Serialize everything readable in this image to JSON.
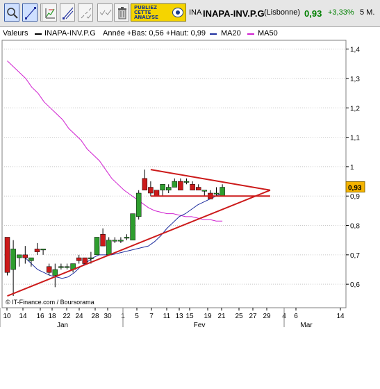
{
  "toolbar": {
    "tools": [
      {
        "name": "zoom-tool-button",
        "icon": "magnifier-icon",
        "active": true
      },
      {
        "name": "trendline-tool-button",
        "icon": "trendline-icon",
        "active": true
      },
      {
        "name": "channel-tool-button",
        "icon": "channel-icon",
        "active": false
      },
      {
        "name": "hline-tool-button",
        "icon": "horizontal-line-icon",
        "active": false
      },
      {
        "name": "fibonacci-tool-button",
        "icon": "fibonacci-icon",
        "active": false
      },
      {
        "name": "fan-tool-button",
        "icon": "fan-icon",
        "active": false
      },
      {
        "name": "erase-tool-button",
        "icon": "checkmarks-icon",
        "active": false
      },
      {
        "name": "trash-tool-button",
        "icon": "trash-icon",
        "active": false
      }
    ],
    "brand": {
      "line1": "PUBLIEZ",
      "line2": "CETTE",
      "line3": "ANALYSE"
    }
  },
  "header": {
    "ticker": "INA",
    "isin": "INAPA-INV.P.G",
    "market": "(Lisbonne)",
    "price": "0,93",
    "change": "+3,33%",
    "period": "5 M."
  },
  "legend": {
    "title": "Valeurs",
    "series_name": "INAPA-INV.P.G",
    "stats": "Année +Bas: 0,56 +Haut: 0,99",
    "ma20": "MA20",
    "ma50": "MA50"
  },
  "colors": {
    "up": "#2e9e2e",
    "down": "#cc1a1a",
    "ma20": "#1f2f9f",
    "ma50": "#d020d0",
    "trendline": "#cc1a1a",
    "last_price_tag": "#f5b400"
  },
  "credit": "© IT-Finance.com / Boursorama",
  "chart_data": {
    "type": "candlestick",
    "ylim": [
      0.52,
      1.43
    ],
    "yticks": [
      "1,4",
      "1,3",
      "1,2",
      "1,1",
      "1",
      "0,9",
      "0,8",
      "0,7",
      "0,6"
    ],
    "xticks": [
      "10",
      "14",
      "16",
      "18",
      "22",
      "24",
      "28",
      "30",
      "1",
      "5",
      "7",
      "11",
      "13",
      "15",
      "19",
      "21",
      "25",
      "27",
      "29",
      "4",
      "6",
      "14"
    ],
    "months": [
      "Jan",
      "Fev",
      "Mar"
    ],
    "last_price": "0,93",
    "candles": [
      {
        "o": 0.76,
        "h": 0.76,
        "l": 0.63,
        "c": 0.64
      },
      {
        "o": 0.65,
        "h": 0.75,
        "l": 0.56,
        "c": 0.72
      },
      {
        "o": 0.69,
        "h": 0.7,
        "l": 0.66,
        "c": 0.7
      },
      {
        "o": 0.7,
        "h": 0.73,
        "l": 0.67,
        "c": 0.69
      },
      {
        "o": 0.68,
        "h": 0.69,
        "l": 0.66,
        "c": 0.69
      },
      {
        "o": 0.72,
        "h": 0.74,
        "l": 0.7,
        "c": 0.71
      },
      {
        "o": 0.72,
        "h": 0.72,
        "l": 0.7,
        "c": 0.72
      },
      {
        "o": 0.66,
        "h": 0.67,
        "l": 0.63,
        "c": 0.64
      },
      {
        "o": 0.63,
        "h": 0.67,
        "l": 0.59,
        "c": 0.65
      },
      {
        "o": 0.66,
        "h": 0.67,
        "l": 0.65,
        "c": 0.66
      },
      {
        "o": 0.66,
        "h": 0.67,
        "l": 0.65,
        "c": 0.66
      },
      {
        "o": 0.65,
        "h": 0.67,
        "l": 0.64,
        "c": 0.67
      },
      {
        "o": 0.69,
        "h": 0.7,
        "l": 0.67,
        "c": 0.68
      },
      {
        "o": 0.69,
        "h": 0.69,
        "l": 0.67,
        "c": 0.67
      },
      {
        "o": 0.69,
        "h": 0.71,
        "l": 0.67,
        "c": 0.69
      },
      {
        "o": 0.7,
        "h": 0.76,
        "l": 0.7,
        "c": 0.76
      },
      {
        "o": 0.77,
        "h": 0.79,
        "l": 0.73,
        "c": 0.73
      },
      {
        "o": 0.7,
        "h": 0.76,
        "l": 0.7,
        "c": 0.75
      },
      {
        "o": 0.75,
        "h": 0.76,
        "l": 0.74,
        "c": 0.75
      },
      {
        "o": 0.75,
        "h": 0.76,
        "l": 0.74,
        "c": 0.75
      },
      {
        "o": 0.76,
        "h": 0.77,
        "l": 0.75,
        "c": 0.76
      },
      {
        "o": 0.75,
        "h": 0.84,
        "l": 0.75,
        "c": 0.84
      },
      {
        "o": 0.83,
        "h": 0.92,
        "l": 0.82,
        "c": 0.91
      },
      {
        "o": 0.96,
        "h": 0.99,
        "l": 0.92,
        "c": 0.92
      },
      {
        "o": 0.93,
        "h": 0.95,
        "l": 0.9,
        "c": 0.91
      },
      {
        "o": 0.92,
        "h": 0.92,
        "l": 0.9,
        "c": 0.9
      },
      {
        "o": 0.92,
        "h": 0.94,
        "l": 0.9,
        "c": 0.94
      },
      {
        "o": 0.92,
        "h": 0.94,
        "l": 0.91,
        "c": 0.93
      },
      {
        "o": 0.93,
        "h": 0.96,
        "l": 0.93,
        "c": 0.95
      },
      {
        "o": 0.95,
        "h": 0.96,
        "l": 0.92,
        "c": 0.92
      },
      {
        "o": 0.95,
        "h": 0.96,
        "l": 0.94,
        "c": 0.95
      },
      {
        "o": 0.94,
        "h": 0.95,
        "l": 0.92,
        "c": 0.92
      },
      {
        "o": 0.93,
        "h": 0.94,
        "l": 0.92,
        "c": 0.92
      },
      {
        "o": 0.92,
        "h": 0.92,
        "l": 0.9,
        "c": 0.92
      },
      {
        "o": 0.91,
        "h": 0.92,
        "l": 0.89,
        "c": 0.89
      },
      {
        "o": 0.91,
        "h": 0.93,
        "l": 0.9,
        "c": 0.91
      },
      {
        "o": 0.9,
        "h": 0.94,
        "l": 0.9,
        "c": 0.93
      }
    ],
    "ma20": [
      0.69,
      0.67,
      0.65,
      0.64,
      0.63,
      0.625,
      0.62,
      0.625,
      0.64,
      0.66,
      0.675,
      0.69,
      0.7,
      0.7,
      0.7,
      0.705,
      0.71,
      0.715,
      0.72,
      0.725,
      0.73,
      0.745,
      0.765,
      0.79,
      0.81,
      0.83,
      0.84,
      0.855,
      0.87,
      0.88,
      0.89,
      0.9,
      0.91
    ],
    "ma50": [
      1.36,
      1.34,
      1.32,
      1.3,
      1.27,
      1.25,
      1.22,
      1.2,
      1.18,
      1.16,
      1.13,
      1.11,
      1.09,
      1.06,
      1.04,
      1.02,
      0.99,
      0.96,
      0.94,
      0.92,
      0.905,
      0.89,
      0.875,
      0.86,
      0.85,
      0.845,
      0.84,
      0.84,
      0.835,
      0.83,
      0.83,
      0.825,
      0.82,
      0.82,
      0.815,
      0.815
    ],
    "trendlines": [
      {
        "name": "lower-support-trendline",
        "from": [
          0,
          0.56
        ],
        "to": [
          44,
          0.92
        ]
      },
      {
        "name": "upper-resistance-trendline",
        "from": [
          24,
          0.99
        ],
        "to": [
          44,
          0.92
        ]
      },
      {
        "name": "horizontal-support-trendline",
        "from": [
          24,
          0.9
        ],
        "to": [
          44,
          0.9
        ]
      }
    ]
  }
}
